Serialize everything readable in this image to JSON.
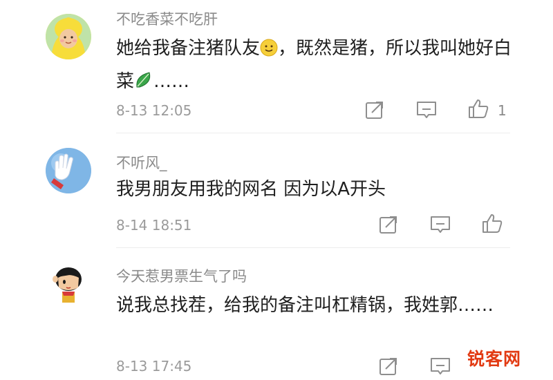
{
  "comments": [
    {
      "username": "不吃香菜不吃肝",
      "text_part1": "她给我备注猪队友",
      "text_part2": "，既然是猪，所以我叫她好白菜",
      "text_part3": "……",
      "time": "8-13 12:05",
      "likes": "1",
      "emojis": [
        "smile-emoji",
        "leaf-emoji"
      ]
    },
    {
      "username": "不听风_",
      "text": "我男朋友用我的网名   因为以A开头",
      "time": "8-14 18:51"
    },
    {
      "username": "今天惹男票生气了吗",
      "text": "说我总找茬，给我的备注叫杠精锅，我姓郭……",
      "time": "8-13 17:45"
    }
  ],
  "icons": [
    "share-icon",
    "reply-icon",
    "like-icon"
  ],
  "watermark": "锐客网",
  "colors": {
    "username": "#8a8a8a",
    "text": "#1f1f1f",
    "meta": "#9a9a9a",
    "watermark": "#e23a12"
  }
}
